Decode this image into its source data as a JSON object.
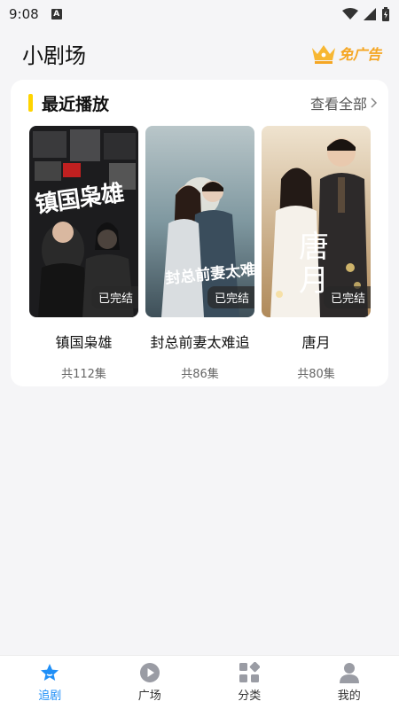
{
  "status_bar": {
    "time": "9:08",
    "a_badge": "A"
  },
  "header": {
    "title": "小剧场",
    "ad_free_label": "免广告"
  },
  "recent": {
    "title": "最近播放",
    "view_all_label": "查看全部",
    "items": [
      {
        "title": "镇国枭雄",
        "episodes": "共112集",
        "status": "已完结",
        "poster_text": "镇国枭雄"
      },
      {
        "title": "封总前妻太难追",
        "episodes": "共86集",
        "status": "已完结",
        "poster_text": "封总前妻太难追"
      },
      {
        "title": "唐月",
        "episodes": "共80集",
        "status": "已完结",
        "poster_text": "唐月"
      }
    ]
  },
  "tabbar": {
    "tabs": [
      {
        "label": "追剧",
        "icon": "star-icon",
        "active": true
      },
      {
        "label": "广场",
        "icon": "play-icon",
        "active": false
      },
      {
        "label": "分类",
        "icon": "category-icon",
        "active": false
      },
      {
        "label": "我的",
        "icon": "profile-icon",
        "active": false
      }
    ]
  },
  "colors": {
    "accent": "#ffd400",
    "tab_active": "#1f8ff7",
    "ad_free": "#f5a623"
  }
}
